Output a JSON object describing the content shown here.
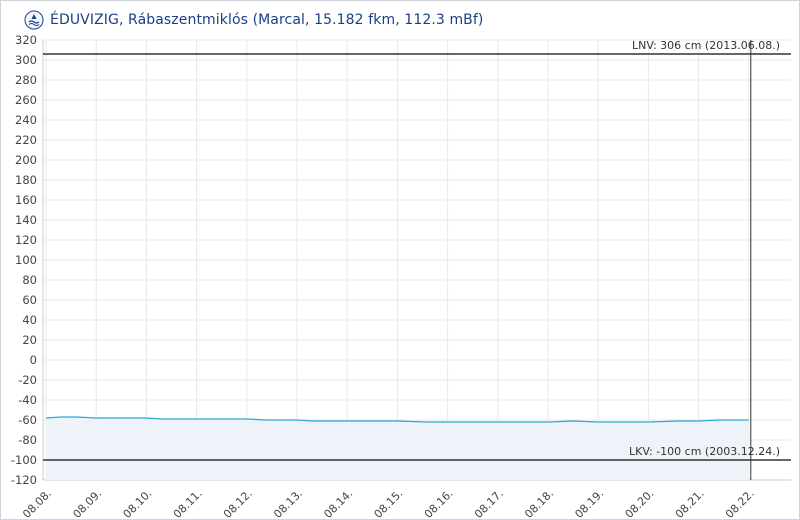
{
  "header": {
    "title": "ÉDUVIZIG, Rábaszentmiklós (Marcal, 15.182 fkm, 112.3 mBf)",
    "logo_icon": "eduvizig-logo-icon"
  },
  "chart_data": {
    "type": "area",
    "title": "ÉDUVIZIG, Rábaszentmiklós (Marcal, 15.182 fkm, 112.3 mBf)",
    "xlabel": "",
    "ylabel": "",
    "ylim": [
      -120,
      320
    ],
    "yticks": [
      320,
      300,
      280,
      260,
      240,
      220,
      200,
      180,
      160,
      140,
      120,
      100,
      80,
      60,
      40,
      20,
      0,
      -20,
      -40,
      -60,
      -80,
      -100,
      -120
    ],
    "categories": [
      "08.08.",
      "08.09.",
      "08.10.",
      "08.11.",
      "08.12.",
      "08.13.",
      "08.14.",
      "08.15.",
      "08.16.",
      "08.17.",
      "08.18.",
      "08.19.",
      "08.20.",
      "08.21.",
      "08.22."
    ],
    "x": [
      0,
      0.3,
      0.6,
      1,
      2,
      2.3,
      3,
      4,
      4.4,
      5,
      5.3,
      6,
      7,
      7.6,
      8,
      9,
      10,
      10.5,
      11,
      12,
      12.6,
      13,
      13.4,
      14
    ],
    "values": [
      -58,
      -57,
      -57,
      -58,
      -58,
      -59,
      -59,
      -59,
      -60,
      -60,
      -61,
      -61,
      -61,
      -62,
      -62,
      -62,
      -62,
      -61,
      -62,
      -62,
      -61,
      -61,
      -60,
      -60
    ],
    "grid": true,
    "legend": "none",
    "reference_lines": [
      {
        "label": "LNV: 306 cm (2013.06.08.)",
        "value": 306
      },
      {
        "label": "LKV: -100 cm (2003.12.24.)",
        "value": -100
      }
    ],
    "cursor_at": "08.22.",
    "colors": {
      "line": "#29a7d6",
      "area": "#eef3f9",
      "reference": "#333333",
      "grid": "#e8e8e8"
    }
  }
}
